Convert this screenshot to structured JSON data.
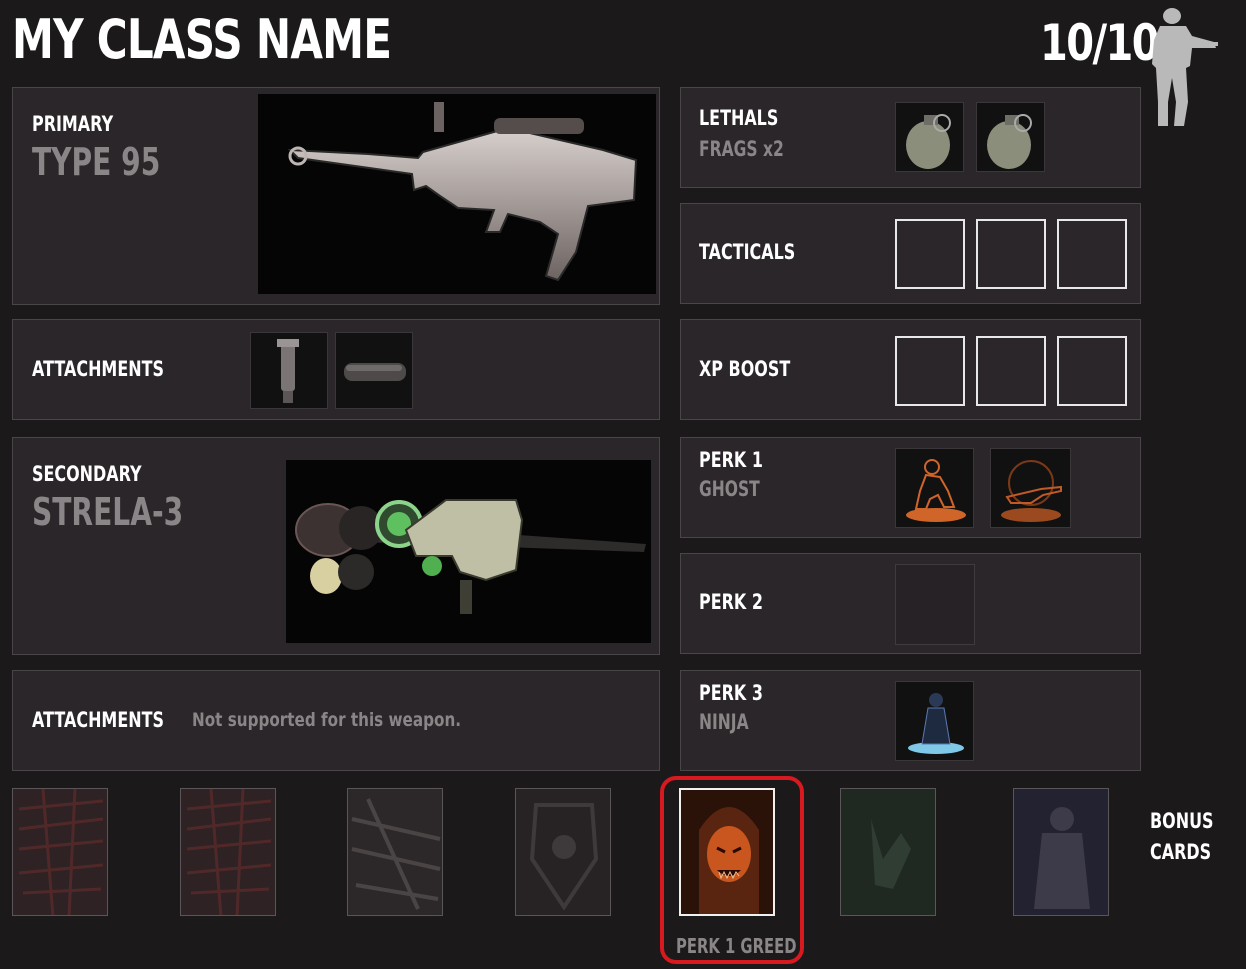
{
  "header": {
    "class_name": "MY CLASS NAME",
    "points": "10/10"
  },
  "primary": {
    "label": "PRIMARY",
    "weapon": "TYPE 95"
  },
  "primary_attachments": {
    "label": "ATTACHMENTS",
    "items": [
      "foregrip-icon",
      "suppressor-icon"
    ]
  },
  "secondary": {
    "label": "SECONDARY",
    "weapon": "STRELA-3"
  },
  "secondary_attachments": {
    "label": "ATTACHMENTS",
    "note": "Not supported for this weapon."
  },
  "lethals": {
    "label": "LETHALS",
    "item": "FRAGS x2",
    "slots": [
      "grenade-icon",
      "grenade-icon"
    ]
  },
  "tacticals": {
    "label": "TACTICALS",
    "slots": [
      "",
      "",
      ""
    ]
  },
  "xp_boost": {
    "label": "XP BOOST",
    "slots": [
      "",
      "",
      ""
    ]
  },
  "perk1": {
    "label": "PERK 1",
    "item": "GHOST",
    "slots": [
      "ghost-perk-icon",
      "perk-sniper-icon"
    ]
  },
  "perk2": {
    "label": "PERK 2"
  },
  "perk3": {
    "label": "PERK 3",
    "item": "NINJA",
    "slots": [
      "ninja-perk-icon"
    ]
  },
  "bonus_cards": {
    "label_line1": "BONUS",
    "label_line2": "CARDS",
    "selected_label": "PERK 1 GREED",
    "cards": [
      {
        "icon": "overkill-card-icon",
        "tint": "#5a2a2a",
        "selected": false
      },
      {
        "icon": "overkill-card-icon",
        "tint": "#5a2a2a",
        "selected": false
      },
      {
        "icon": "weapons-card-icon",
        "tint": "#4a4444",
        "selected": false
      },
      {
        "icon": "shield-card-icon",
        "tint": "#3e3a3c",
        "selected": false
      },
      {
        "icon": "greed-card-icon",
        "tint": "#c8561e",
        "selected": true
      },
      {
        "icon": "hand-card-icon",
        "tint": "#2f3d33",
        "selected": false
      },
      {
        "icon": "figure-card-icon",
        "tint": "#3d3a4a",
        "selected": false
      }
    ]
  },
  "colors": {
    "background": "#1c191b",
    "panel": "#2a2629",
    "highlight_frame": "#d71920",
    "muted_text": "#8a8688"
  }
}
